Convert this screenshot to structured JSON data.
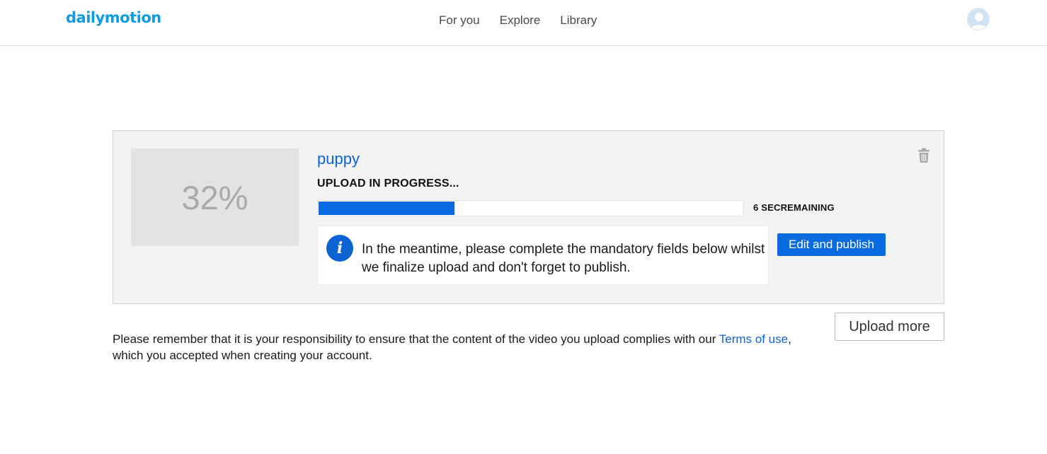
{
  "header": {
    "logo": "dailymotion",
    "nav": [
      "For you",
      "Explore",
      "Library"
    ]
  },
  "upload": {
    "thumbnail_percent_text": "32%",
    "progress_fraction": 0.32,
    "video_title": "puppy",
    "status": "UPLOAD IN PROGRESS...",
    "remaining": "6 SECREMAINING",
    "info_message": "In the meantime, please complete the mandatory fields below whilst we finalize upload and don't forget to publish.",
    "edit_button": "Edit and publish"
  },
  "upload_more_button": "Upload more",
  "notice": {
    "before": "Please remember that it is your responsibility to ensure that the content of the video you upload complies with our ",
    "link": "Terms of use",
    "after": ", which you accepted when creating your account."
  },
  "colors": {
    "brand": "#0d9de5",
    "accent": "#0a6be0"
  },
  "icons": {
    "info": "info-icon",
    "trash": "trash-icon",
    "avatar": "avatar-icon"
  }
}
